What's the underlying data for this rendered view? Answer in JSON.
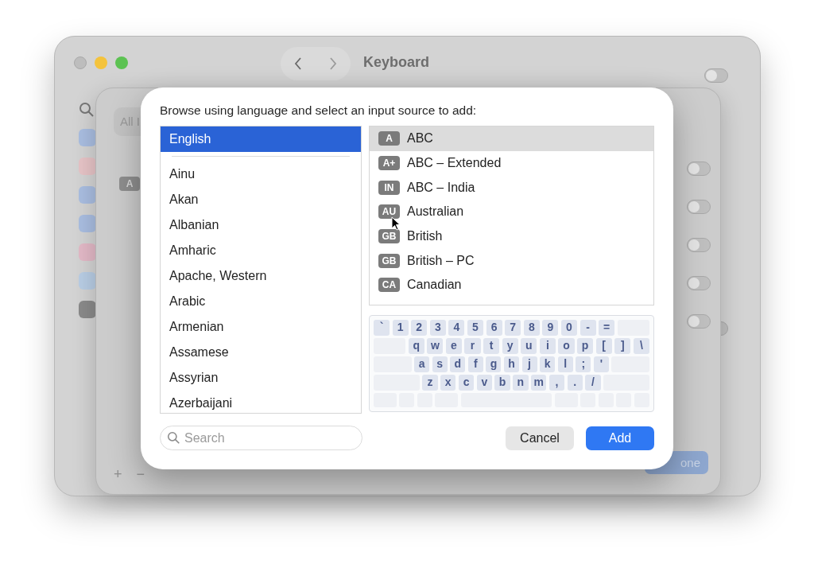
{
  "window": {
    "title": "Keyboard",
    "switches": [
      {
        "on": false
      },
      {
        "on": false
      }
    ]
  },
  "sheet": {
    "search_text": "All I",
    "badge": "A",
    "add_button": "+",
    "remove_button": "−",
    "done_button": "one",
    "switches": [
      {
        "on": false
      },
      {
        "on": false
      },
      {
        "on": false
      },
      {
        "on": false
      },
      {
        "on": false
      }
    ]
  },
  "dialog": {
    "prompt": "Browse using language and select an input source to add:",
    "preferred_languages": [
      {
        "label": "English",
        "selected": true
      }
    ],
    "languages": [
      {
        "label": "Ainu",
        "selected": false
      },
      {
        "label": "Akan",
        "selected": false
      },
      {
        "label": "Albanian",
        "selected": false
      },
      {
        "label": "Amharic",
        "selected": false
      },
      {
        "label": "Apache, Western",
        "selected": false
      },
      {
        "label": "Arabic",
        "selected": false
      },
      {
        "label": "Armenian",
        "selected": false
      },
      {
        "label": "Assamese",
        "selected": false
      },
      {
        "label": "Assyrian",
        "selected": false
      },
      {
        "label": "Azerbaijani",
        "selected": false
      }
    ],
    "input_sources": [
      {
        "badge": "A",
        "label": "ABC",
        "selected": true
      },
      {
        "badge": "A+",
        "label": "ABC – Extended",
        "selected": false
      },
      {
        "badge": "IN",
        "label": "ABC – India",
        "selected": false
      },
      {
        "badge": "AU",
        "label": "Australian",
        "selected": false
      },
      {
        "badge": "GB",
        "label": "British",
        "selected": false
      },
      {
        "badge": "GB",
        "label": "British – PC",
        "selected": false
      },
      {
        "badge": "CA",
        "label": "Canadian",
        "selected": false
      }
    ],
    "keyboard_rows": [
      [
        "`",
        "1",
        "2",
        "3",
        "4",
        "5",
        "6",
        "7",
        "8",
        "9",
        "0",
        "-",
        "="
      ],
      [
        "q",
        "w",
        "e",
        "r",
        "t",
        "y",
        "u",
        "i",
        "o",
        "p",
        "[",
        "]",
        "\\"
      ],
      [
        "a",
        "s",
        "d",
        "f",
        "g",
        "h",
        "j",
        "k",
        "l",
        ";",
        "'"
      ],
      [
        "z",
        "x",
        "c",
        "v",
        "b",
        "n",
        "m",
        ",",
        ".",
        "/"
      ]
    ],
    "search": {
      "placeholder": "Search"
    },
    "buttons": [
      {
        "label": "Cancel",
        "kind": "secondary"
      },
      {
        "label": "Add",
        "kind": "primary"
      }
    ]
  }
}
